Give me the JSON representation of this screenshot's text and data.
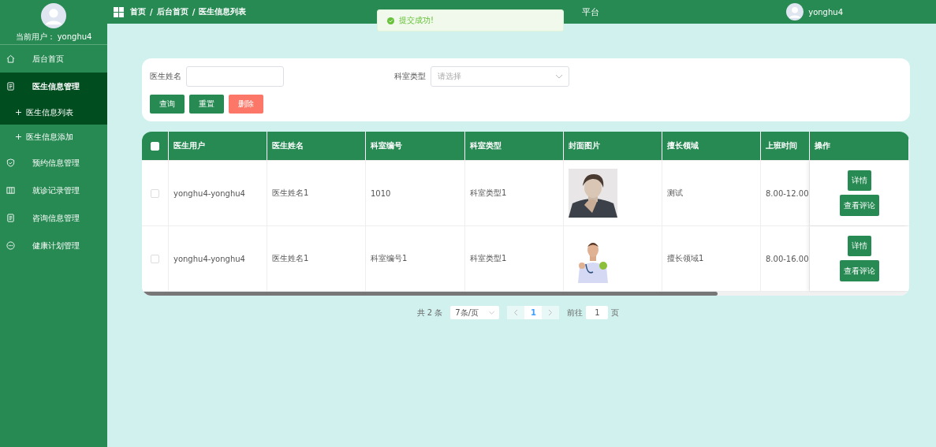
{
  "sidebar": {
    "user_label": "当前用户： yonghu4",
    "items": [
      {
        "label": "后台首页",
        "kind": "home",
        "selected": false
      },
      {
        "label": "医生信息管理",
        "kind": "document",
        "selected": true,
        "expanded": true,
        "children": [
          {
            "label": "医生信息列表",
            "selected": true
          },
          {
            "label": "医生信息添加",
            "selected": false
          }
        ]
      },
      {
        "label": "预约信息管理",
        "kind": "shield",
        "selected": false
      },
      {
        "label": "就诊记录管理",
        "kind": "columns",
        "selected": false
      },
      {
        "label": "咨询信息管理",
        "kind": "document",
        "selected": false
      },
      {
        "label": "健康计划管理",
        "kind": "chat",
        "selected": false
      }
    ]
  },
  "topbar": {
    "breadcrumb": [
      "首页",
      "后台首页",
      "医生信息列表"
    ],
    "breadcrumb_separator": "/",
    "title": "平台",
    "username": "yonghu4"
  },
  "toast": {
    "message": "提交成功!"
  },
  "search": {
    "fields": [
      {
        "label": "医生姓名",
        "kind": "input"
      },
      {
        "label": "科室类型",
        "kind": "select",
        "placeholder": "请选择"
      }
    ],
    "buttons": [
      {
        "label": "查询",
        "kind": "primary"
      },
      {
        "label": "重置",
        "kind": "primary"
      },
      {
        "label": "删除",
        "kind": "danger"
      }
    ]
  },
  "table": {
    "all_checked": false,
    "columns": [
      "医生用户",
      "医生姓名",
      "科室编号",
      "科室类型",
      "封面图片",
      "擅长领域",
      "上班时间",
      "操作"
    ],
    "rows": [
      {
        "checked": false,
        "cells": [
          "yonghu4-yonghu4",
          "医生姓名1",
          "1010",
          "科室类型1"
        ],
        "field": "测试",
        "time": "8.00-12.00",
        "actions": [
          "详情",
          "查看评论"
        ]
      },
      {
        "checked": false,
        "cells": [
          "yonghu4-yonghu4",
          "医生姓名1",
          "科室编号1",
          "科室类型1"
        ],
        "field": "擅长领域1",
        "time": "8.00-16.00",
        "actions": [
          "详情",
          "查看评论"
        ]
      }
    ]
  },
  "pagination": {
    "total": "共 2 条",
    "page_size": "7条/页",
    "pages": [
      {
        "label": "1",
        "selected": true
      }
    ],
    "goto_label": "前往",
    "goto_value": "1",
    "goto_suffix": "页"
  }
}
